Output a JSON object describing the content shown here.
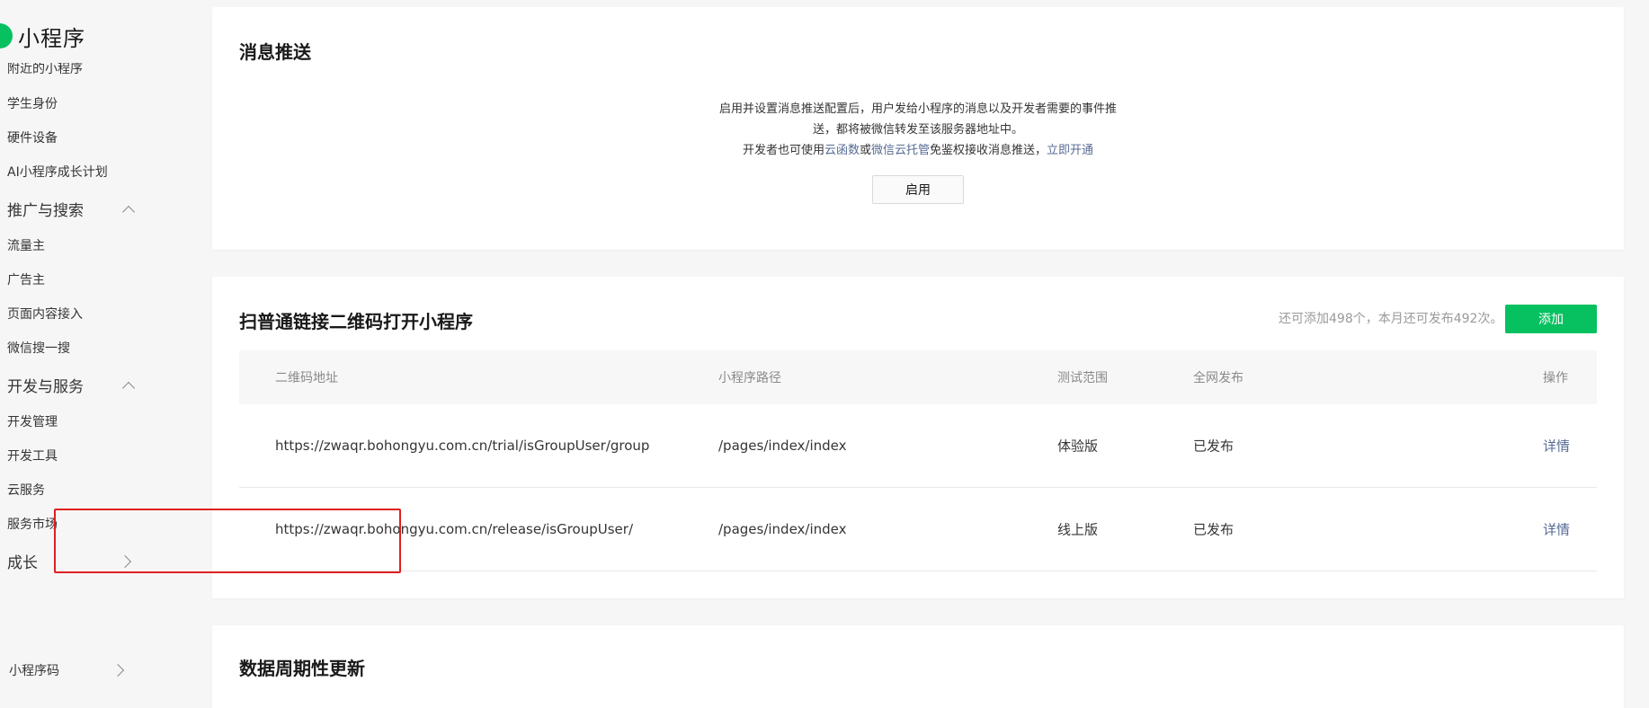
{
  "sidebar": {
    "brand": "小程序",
    "items": [
      {
        "label": "附近的小程序"
      },
      {
        "label": "学生身份"
      },
      {
        "label": "硬件设备"
      },
      {
        "label": "AI小程序成长计划"
      }
    ],
    "groups": {
      "promotion": {
        "label": "推广与搜索",
        "items": [
          "流量主",
          "广告主",
          "页面内容接入",
          "微信搜一搜"
        ]
      },
      "dev": {
        "label": "开发与服务",
        "items": [
          "开发管理",
          "开发工具",
          "云服务",
          "服务市场"
        ]
      },
      "growth": {
        "label": "成长"
      }
    },
    "mini_code": "小程序码"
  },
  "push": {
    "title": "消息推送",
    "desc_line1": "启用并设置消息推送配置后，用户发给小程序的消息以及开发者需要的事件推",
    "desc_line2": "送，都将被微信转发至该服务器地址中。",
    "desc_prefix": "开发者也可使用",
    "link_cloud_func": "云函数",
    "desc_or": "或",
    "link_cloud_host": "微信云托管",
    "desc_suffix": "免鉴权接收消息推送，",
    "link_open_now": "立即开通",
    "enable_label": "启用"
  },
  "qr": {
    "title": "扫普通链接二维码打开小程序",
    "quota": "还可添加498个，本月还可发布492次。",
    "add_label": "添加",
    "headers": [
      "二维码地址",
      "小程序路径",
      "测试范围",
      "全网发布",
      "操作"
    ],
    "rows": [
      {
        "url": "https://zwaqr.bohongyu.com.cn/trial/isGroupUser/group",
        "path": "/pages/index/index",
        "scope": "体验版",
        "status": "已发布",
        "action": "详情"
      },
      {
        "url": "https://zwaqr.bohongyu.com.cn/release/isGroupUser/",
        "path": "/pages/index/index",
        "scope": "线上版",
        "status": "已发布",
        "action": "详情"
      }
    ]
  },
  "periodic": {
    "title": "数据周期性更新"
  },
  "colors": {
    "brand_green": "#07c160",
    "link_blue": "#576b95",
    "highlight_red": "#e02020"
  }
}
